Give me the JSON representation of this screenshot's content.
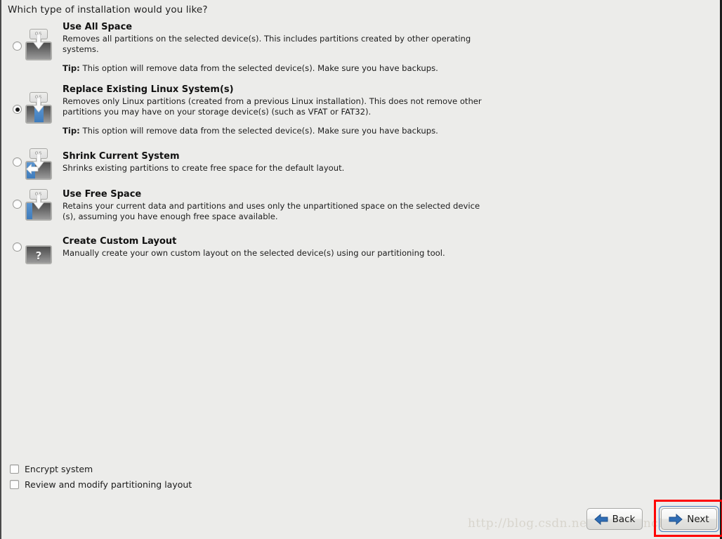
{
  "page": {
    "title": "Which type of installation would you like?"
  },
  "options": [
    {
      "id": "use-all-space",
      "title": "Use All Space",
      "description": "Removes all partitions on the selected device(s).  This includes partitions created by other operating systems.",
      "tip_label": "Tip:",
      "tip_text": "This option will remove data from the selected device(s).  Make sure you have backups.",
      "selected": false,
      "icon": "disk-erase-all-icon",
      "os_tag": "OS"
    },
    {
      "id": "replace-existing-linux",
      "title": "Replace Existing Linux System(s)",
      "description": "Removes only Linux partitions (created from a previous Linux installation).  This does not remove other partitions you may have on your storage device(s) (such as VFAT or FAT32).",
      "tip_label": "Tip:",
      "tip_text": "This option will remove data from the selected device(s).  Make sure you have backups.",
      "selected": true,
      "icon": "disk-replace-linux-icon",
      "os_tag": "OS"
    },
    {
      "id": "shrink-current-system",
      "title": "Shrink Current System",
      "description": "Shrinks existing partitions to create free space for the default layout.",
      "tip_label": "",
      "tip_text": "",
      "selected": false,
      "icon": "disk-shrink-icon",
      "os_tag": "OS"
    },
    {
      "id": "use-free-space",
      "title": "Use Free Space",
      "description": "Retains your current data and partitions and uses only the unpartitioned space on the selected device (s), assuming you have enough free space available.",
      "tip_label": "",
      "tip_text": "",
      "selected": false,
      "icon": "disk-free-space-icon",
      "os_tag": "OS"
    },
    {
      "id": "create-custom-layout",
      "title": "Create Custom Layout",
      "description": "Manually create your own custom layout on the selected device(s) using our partitioning tool.",
      "tip_label": "",
      "tip_text": "",
      "selected": false,
      "icon": "disk-custom-layout-icon",
      "os_tag": "?"
    }
  ],
  "checkboxes": [
    {
      "id": "encrypt-system",
      "label": "Encrypt system",
      "checked": false
    },
    {
      "id": "review-modify-partitioning",
      "label": "Review and modify partitioning layout",
      "checked": false
    }
  ],
  "buttons": {
    "back": {
      "label": "Back",
      "icon": "arrow-left-icon"
    },
    "next": {
      "label": "Next",
      "icon": "arrow-right-icon",
      "focused": true,
      "highlighted": true
    }
  },
  "watermark": {
    "text": "http://blog.csdn.net/MusicEnchanter"
  },
  "colors": {
    "background": "#ececea",
    "accent_blue": "#3f7cbc",
    "highlight_red": "#ff0000",
    "focus_ring": "#4a7fbd"
  }
}
